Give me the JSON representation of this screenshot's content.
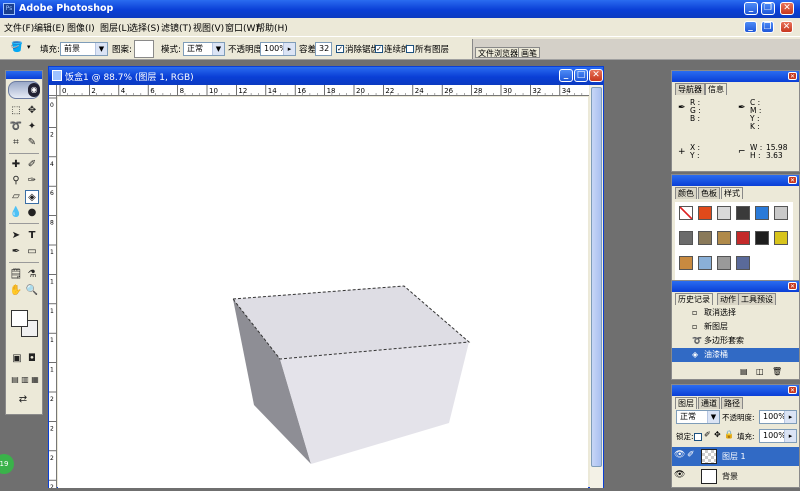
{
  "app": {
    "title": "Adobe Photoshop",
    "logo": "Ps"
  },
  "menu": [
    "文件(F)",
    "编辑(E)",
    "图像(I)",
    "图层(L)",
    "选择(S)",
    "滤镜(T)",
    "视图(V)",
    "窗口(W)",
    "帮助(H)"
  ],
  "options_bar": {
    "fill_label": "填充:",
    "fill_value": "前景",
    "pattern_label": "图案:",
    "mode_label": "模式:",
    "mode_value": "正常",
    "opacity_label": "不透明度:",
    "opacity_value": "100%",
    "tolerance_label": "容差:",
    "tolerance_value": "32",
    "anti_alias_label": "消除锯齿",
    "contiguous_label": "连续的",
    "all_layers_label": "所有图层",
    "anti_alias_checked": true,
    "contiguous_checked": true,
    "all_layers_checked": false,
    "well_tabs": [
      "文件浏览器",
      "画笔"
    ]
  },
  "document": {
    "title": "饭盒1 @ 88.7% (图层 1, RGB)",
    "ruler_ticks": [
      "0",
      "2",
      "4",
      "6",
      "8",
      "10",
      "12",
      "14",
      "16",
      "18",
      "20",
      "22",
      "24",
      "26",
      "28",
      "30",
      "32",
      "34"
    ],
    "v_ruler_ticks": [
      "0",
      "2",
      "4",
      "6",
      "8",
      "1",
      "1",
      "1",
      "1",
      "1",
      "2",
      "2",
      "2",
      "2"
    ]
  },
  "navigator_panel": {
    "tabs": [
      "导航器",
      "信息"
    ],
    "r_label": "R :",
    "g_label": "G :",
    "b_label": "B :",
    "c_label": "C :",
    "m_label": "M :",
    "y_label": "Y :",
    "k_label": "K :",
    "x_label": "X :",
    "y2_label": "Y :",
    "w_label": "W :",
    "w_value": "15.98",
    "h_label": "H :",
    "h_value": "3.63"
  },
  "swatches_panel": {
    "tabs": [
      "颜色",
      "色板",
      "样式"
    ],
    "colors": [
      "#ffffff",
      "#e04a1a",
      "#d9d9d9",
      "#3a3a3a",
      "#2a7ad8",
      "#c9c9c9",
      "#6b6b6b",
      "#8a7a5a",
      "#b08a4a",
      "#c42a2a",
      "#1e1e1e",
      "#d8c41c",
      "#c88a40",
      "#8ab0d8",
      "#9a9a9a",
      "#5a6a9a"
    ]
  },
  "history_panel": {
    "tabs": [
      "历史记录",
      "动作",
      "工具预设"
    ],
    "items": [
      "取消选择",
      "新图层",
      "多边形套索",
      "油漆桶"
    ]
  },
  "layers_panel": {
    "tabs": [
      "图层",
      "通道",
      "路径"
    ],
    "mode_value": "正常",
    "opacity_label": "不透明度:",
    "opacity_value": "100%",
    "lock_label": "锁定:",
    "fill_label": "填充:",
    "fill_value": "100%",
    "layers": [
      "图层 1",
      "背景"
    ]
  },
  "badge_text": "19"
}
